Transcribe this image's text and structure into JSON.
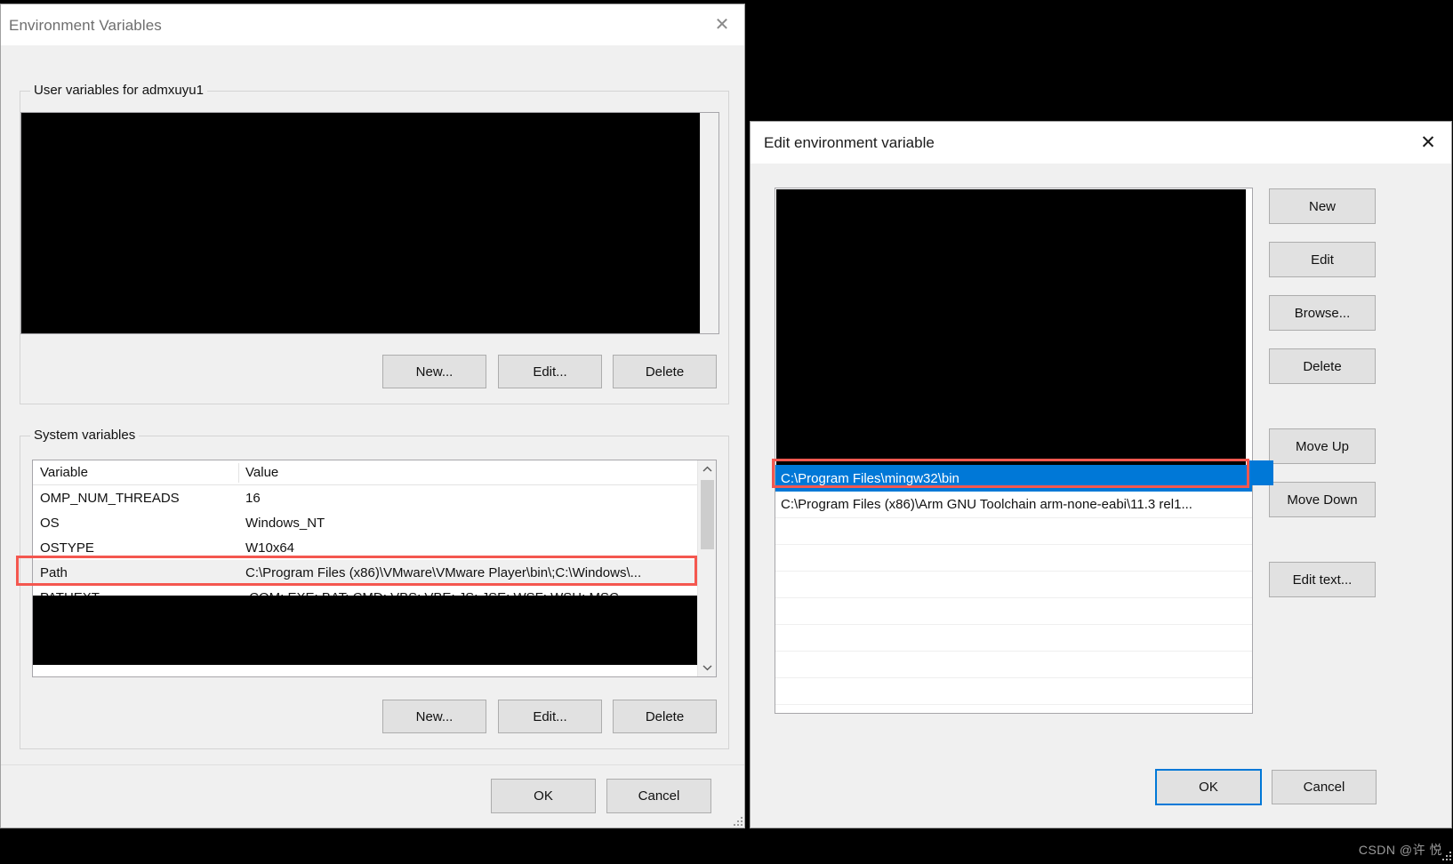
{
  "colors": {
    "accent_selection": "#0078d7",
    "annotation_red": "#f4574f",
    "dialog_bg": "#f0f0f0",
    "button_bg": "#e1e1e1",
    "redaction": "#000000"
  },
  "env_dialog": {
    "title": "Environment Variables",
    "close_icon": "close-icon",
    "user_group": {
      "legend": "User variables for admxuyu1",
      "redacted": true
    },
    "user_buttons": {
      "new": "New...",
      "edit": "Edit...",
      "delete": "Delete"
    },
    "system_group": {
      "legend": "System variables",
      "columns": [
        "Variable",
        "Value"
      ],
      "rows": [
        {
          "variable": "OMP_NUM_THREADS",
          "value": "16",
          "selected": false
        },
        {
          "variable": "OS",
          "value": "Windows_NT",
          "selected": false
        },
        {
          "variable": "OSTYPE",
          "value": "W10x64",
          "selected": false
        },
        {
          "variable": "Path",
          "value": "C:\\Program Files (x86)\\VMware\\VMware Player\\bin\\;C:\\Windows\\...",
          "selected": true
        },
        {
          "variable": "PATHEXT",
          "value": ".COM;.EXE;.BAT;.CMD;.VBS;.VBE;.JS;.JSE;.WSF;.WSH;.MSC",
          "selected": false
        }
      ],
      "scroll_up_icon": "chevron-up-icon",
      "scroll_down_icon": "chevron-down-icon"
    },
    "system_buttons": {
      "new": "New...",
      "edit": "Edit...",
      "delete": "Delete"
    },
    "footer": {
      "ok": "OK",
      "cancel": "Cancel"
    },
    "resize_grip_icon": "resize-grip-icon"
  },
  "edit_dialog": {
    "title": "Edit environment variable",
    "close_icon": "close-icon",
    "path_entries": [
      {
        "text": "C:\\Program Files\\mingw32\\bin",
        "selected": true
      },
      {
        "text": "C:\\Program Files (x86)\\Arm GNU Toolchain arm-none-eabi\\11.3 rel1...",
        "selected": false
      }
    ],
    "side_buttons": {
      "new": "New",
      "edit": "Edit",
      "browse": "Browse...",
      "delete": "Delete",
      "move_up": "Move Up",
      "move_down": "Move Down",
      "edit_text": "Edit text..."
    },
    "footer": {
      "ok": "OK",
      "cancel": "Cancel"
    }
  },
  "watermark": {
    "text": "CSDN @许 悦"
  }
}
